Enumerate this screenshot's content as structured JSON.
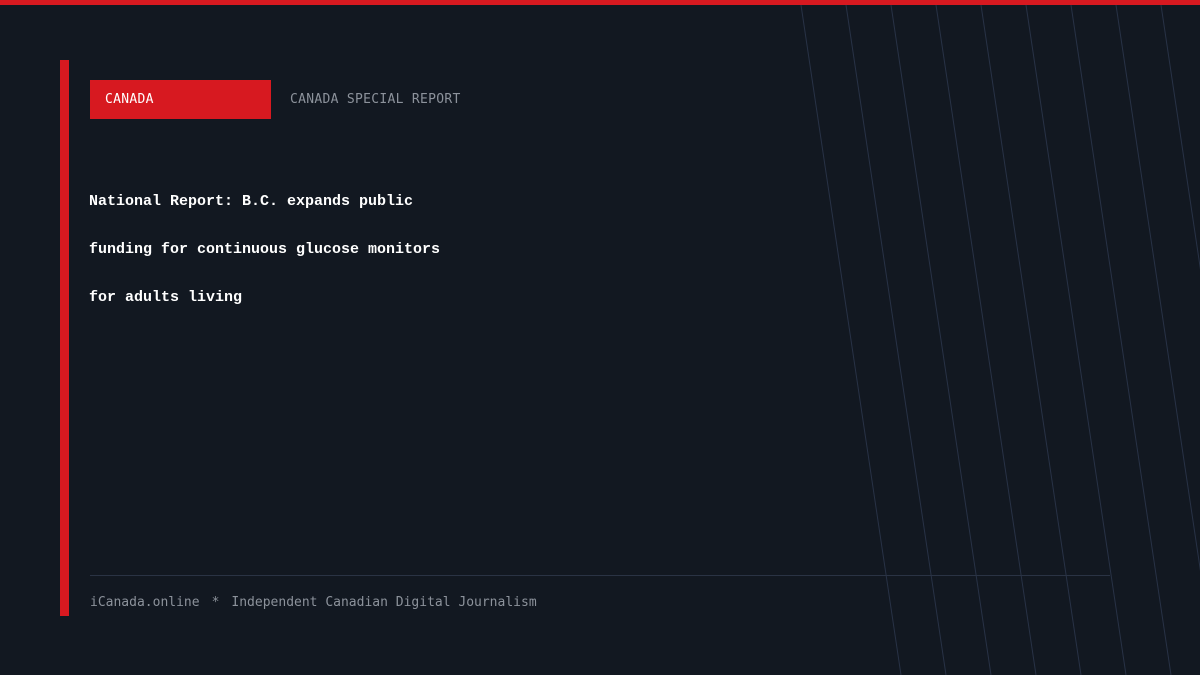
{
  "colors": {
    "background": "#121821",
    "accent": "#d71920",
    "headline": "#ffffff",
    "muted_text": "#8c929b",
    "decorative_lines": "#283246"
  },
  "tag": {
    "label": "CANADA"
  },
  "report_label": "CANADA SPECIAL REPORT",
  "headline": {
    "lines": [
      "National Report: B.C. expands public",
      "funding for continuous glucose monitors",
      "for adults living"
    ]
  },
  "footer": {
    "site": "iCanada.online",
    "separator": "*",
    "tagline": "Independent Canadian Digital Journalism"
  }
}
